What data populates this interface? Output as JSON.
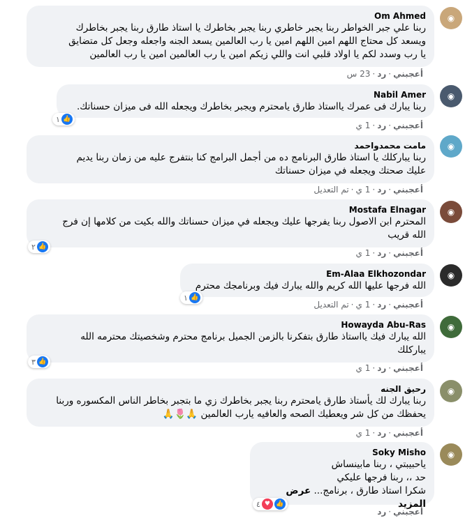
{
  "comments": [
    {
      "author": "Om Ahmed",
      "lines": [
        "ربنا علي جبر الخواطر ربنا يجبر خاطري ربنا يجبر بخاطرك يا استاذ طارق ربنا يجبر بخاطرك",
        "ويسعد كل محتاج اللهم امين اللهم امين يا رب العالمين يسعد الجنه واجعله وجعل كل متضايق",
        "يا رب وسدد لكم يا اولاد قلبي انت واللي زيكم امين يا رب العالمين امين يا رب العالمين"
      ],
      "like": "أعجبني",
      "reply": "رد",
      "time": "23 س",
      "edited": "",
      "reactions": "",
      "avatar_color": "#c9a77a"
    },
    {
      "author": "Nabil Amer",
      "lines": [
        "ربنا يبارك فى عمرك يااستاذ طارق يامحترم ويجبر بخاطرك ويجعله الله فى ميزان حسناتك."
      ],
      "like": "أعجبني",
      "reply": "رد",
      "time": "1 ي",
      "edited": "",
      "reactions": "١",
      "avatar_color": "#4a5a6e"
    },
    {
      "author": "مامت محمدواحمد",
      "lines": [
        "ربنا يباركلك يا استاذ طارق البرنامج ده من أجمل البرامج كنا بنتفرج عليه من زمان ربنا يديم",
        "عليك صحتك ويجعله في ميزان حسناتك"
      ],
      "like": "أعجبني",
      "reply": "رد",
      "time": "1 ي",
      "edited": "تم التعديل",
      "reactions": "",
      "avatar_color": "#5fa8c9"
    },
    {
      "author": "Mostafa Elnagar",
      "lines": [
        "المحترم ابن الاصول ربنا يفرجها عليك ويجعله في ميزان حسناتك والله بكيت من كلامها إن فرج",
        "الله قريب"
      ],
      "like": "أعجبني",
      "reply": "رد",
      "time": "1 ي",
      "edited": "",
      "reactions": "٢",
      "avatar_color": "#7a4b3a"
    },
    {
      "author": "Em-Alaa Elkhozondar",
      "lines": [
        "الله فرجها عليها الله كريم والله يبارك فيك وبرنامجك محترم"
      ],
      "like": "أعجبني",
      "reply": "رد",
      "time": "1 ي",
      "edited": "تم التعديل",
      "reactions": "١",
      "avatar_color": "#2b2b2b"
    },
    {
      "author": "Howayda Abu-Ras",
      "lines": [
        "الله يبارك فيك يااستاذ طارق بتفكرنا بالزمن الجميل برنامج محترم وشخصيتك محترمه الله",
        "يباركلك"
      ],
      "like": "أعجبني",
      "reply": "رد",
      "time": "1 ي",
      "edited": "",
      "reactions": "٣",
      "avatar_color": "#3f6b3a"
    },
    {
      "author": "رحيق الجنه",
      "lines": [
        "ربنا يبارك لك يأستاذ طارق يامحترم ربنا يجبر بخاطرك زي ما بتجبر بخاطر الناس المكسوره وربنا",
        "يحفظك من كل شر ويعطيك الصحه والعافيه يارب العالمين 🙏🌷🙏"
      ],
      "like": "أعجبني",
      "reply": "رد",
      "time": "1 ي",
      "edited": "",
      "reactions": "",
      "avatar_color": "#8a8f6a"
    },
    {
      "author": "Soky Misho",
      "lines": [
        "ياحبيبتي ، ربنا مابينساش",
        "حد ،، ربنا فرجها عليكي",
        "شكرا استاذ طارق ، برنامج..."
      ],
      "see_more": "عرض المزيد",
      "like": "أعجبني",
      "reply": "رد",
      "time": "",
      "edited": "",
      "reactions": "٤",
      "avatar_color": "#9a8a5a"
    }
  ]
}
